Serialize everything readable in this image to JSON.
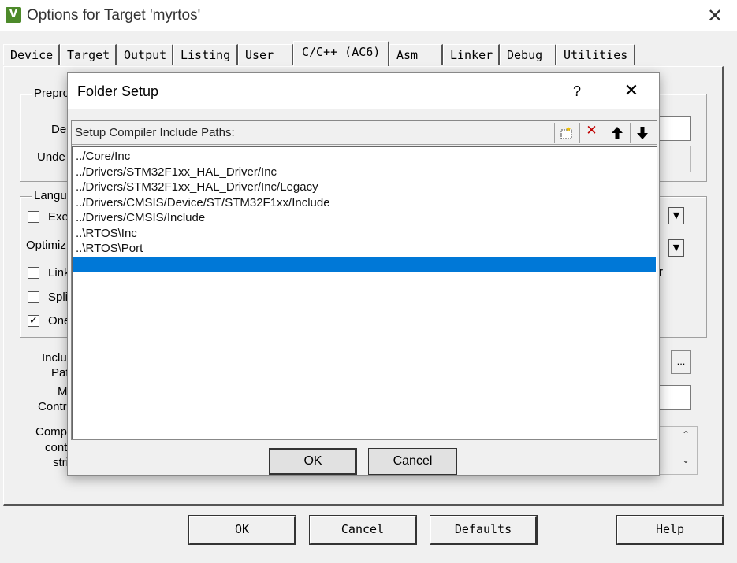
{
  "window": {
    "app_icon": "keil-uvision-icon",
    "app_icon_glyph": "V",
    "title": "Options for Target 'myrtos'",
    "close_glyph": "✕"
  },
  "tabs": [
    {
      "label": "Device"
    },
    {
      "label": "Target"
    },
    {
      "label": "Output"
    },
    {
      "label": "Listing"
    },
    {
      "label": "User"
    },
    {
      "label": "C/C++ (AC6)",
      "active": true
    },
    {
      "label": "Asm"
    },
    {
      "label": "Linker"
    },
    {
      "label": "Debug"
    },
    {
      "label": "Utilities"
    }
  ],
  "background_panel": {
    "preprocessor_group": "Prepro",
    "define_label": "De",
    "undefine_label": "Unde",
    "language_group": "Langu",
    "execute_only_label": "Exe",
    "optimization_label": "Optimiz",
    "link_label": "Link",
    "split_label": "Spli",
    "one_label": "One",
    "one_checked": "✓",
    "include_paths_label_1": "Inclu",
    "include_paths_label_2": "Pat",
    "misc_label_1": "M",
    "misc_label_2": "Contr",
    "compiler_label_1": "Comp",
    "compiler_label_2": "cont",
    "compiler_label_3": "stri",
    "right_fragment": "r",
    "ellipsis_button": "...",
    "scroll_up": "⌃",
    "scroll_down": "⌄",
    "combo_arrow": "▼"
  },
  "bottom_buttons": {
    "ok": "OK",
    "cancel": "Cancel",
    "defaults": "Defaults",
    "help": "Help"
  },
  "dialog": {
    "title": "Folder Setup",
    "help_glyph": "?",
    "close_glyph": "✕",
    "list_header": "Setup Compiler Include Paths:",
    "tools": {
      "new": "new-folder-icon",
      "delete": "delete-icon",
      "up": "move-up-icon",
      "down": "move-down-icon",
      "new_glyph": "▫",
      "delete_glyph": "✕",
      "up_glyph": "🡅",
      "down_glyph": "🡇"
    },
    "paths": [
      "../Core/Inc",
      "../Drivers/STM32F1xx_HAL_Driver/Inc",
      "../Drivers/STM32F1xx_HAL_Driver/Inc/Legacy",
      "../Drivers/CMSIS/Device/ST/STM32F1xx/Include",
      "../Drivers/CMSIS/Include",
      "..\\RTOS\\Inc",
      "..\\RTOS\\Port",
      ""
    ],
    "selected_index": 7,
    "ok_label": "OK",
    "cancel_label": "Cancel",
    "colors": {
      "selection": "#0078d7"
    }
  }
}
